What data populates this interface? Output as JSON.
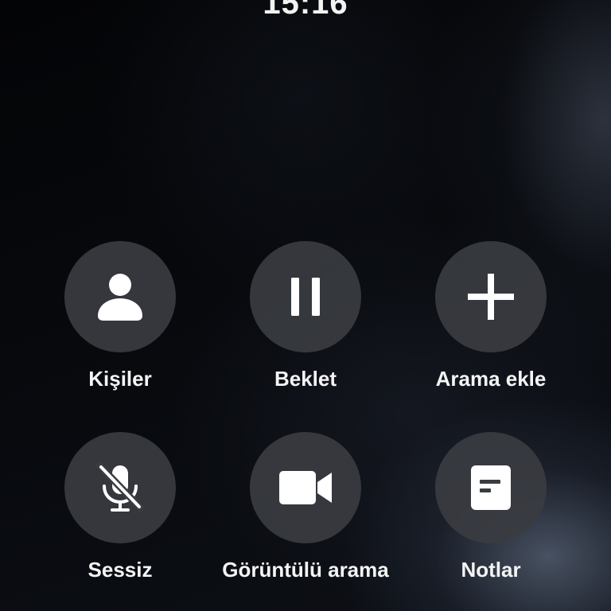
{
  "status": {
    "time": "15:16"
  },
  "actions": [
    {
      "label": "Kişiler",
      "icon": "person-icon"
    },
    {
      "label": "Beklet",
      "icon": "pause-icon"
    },
    {
      "label": "Arama ekle",
      "icon": "plus-icon"
    },
    {
      "label": "Sessiz",
      "icon": "mic-off-icon"
    },
    {
      "label": "Görüntülü arama",
      "icon": "video-camera-icon"
    },
    {
      "label": "Notlar",
      "icon": "note-icon"
    }
  ],
  "colors": {
    "button_bg": "#3a3c41",
    "text": "#ffffff",
    "background": "#050608"
  }
}
